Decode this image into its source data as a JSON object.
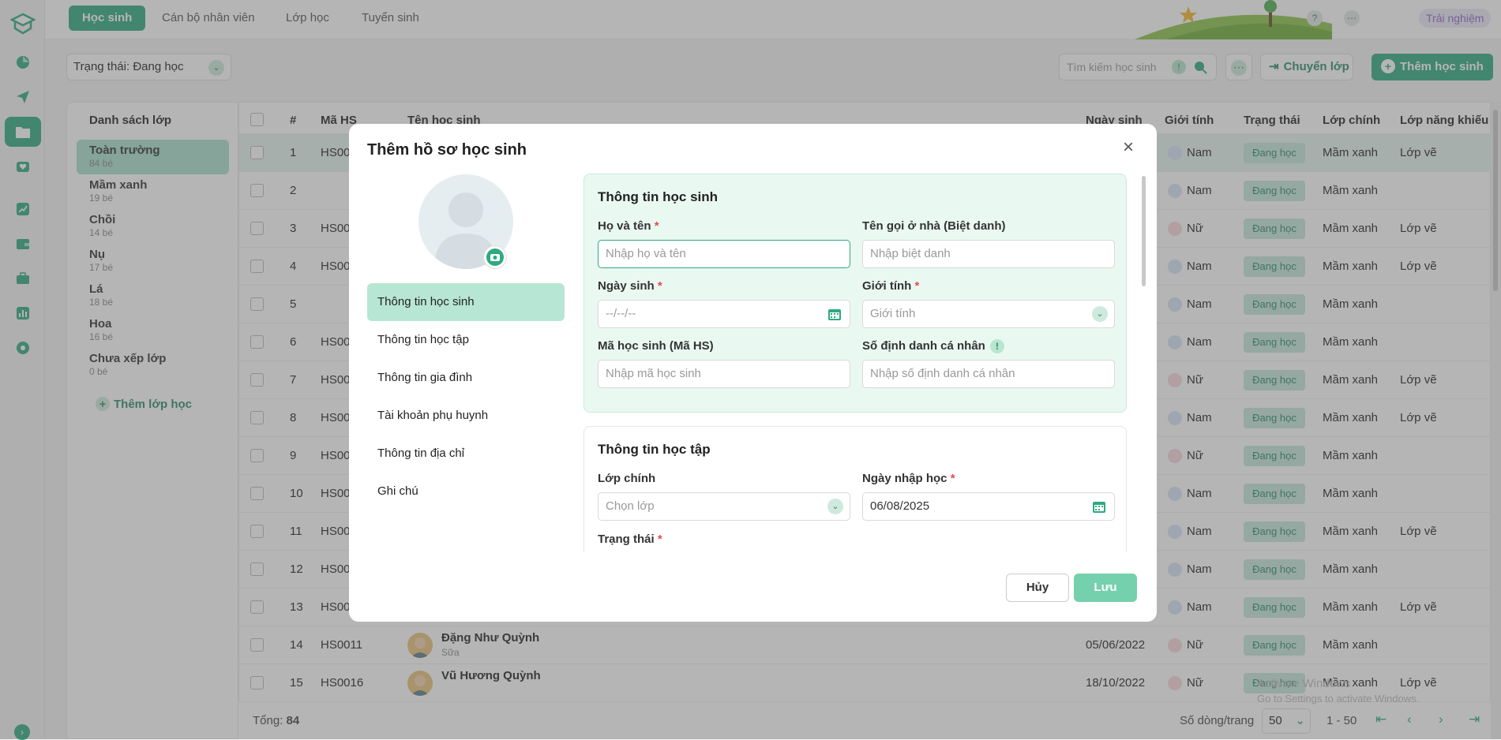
{
  "topbar": {
    "tabs": [
      "Học sinh",
      "Cán bộ nhân viên",
      "Lớp học",
      "Tuyển sinh"
    ],
    "trial_label": "Trải nghiệm"
  },
  "filter": {
    "status_label": "Trạng thái: Đang học",
    "search_placeholder": "Tìm kiếm học sinh",
    "move_class_label": "Chuyển lớp",
    "add_student_label": "Thêm học sinh"
  },
  "classes": {
    "title": "Danh sách lớp",
    "items": [
      {
        "name": "Toàn trường",
        "count": "84 bé"
      },
      {
        "name": "Mầm xanh",
        "count": "19 bé"
      },
      {
        "name": "Chồi",
        "count": "14 bé"
      },
      {
        "name": "Nụ",
        "count": "17 bé"
      },
      {
        "name": "Lá",
        "count": "18 bé"
      },
      {
        "name": "Hoa",
        "count": "16 bé"
      },
      {
        "name": "Chưa xếp lớp",
        "count": "0 bé"
      }
    ],
    "add_label": "Thêm lớp học"
  },
  "table": {
    "headers": {
      "num": "#",
      "code": "Mã HS",
      "name": "Tên học sinh",
      "dob": "Ngày sinh",
      "gender": "Giới tính",
      "status": "Trạng thái",
      "main_class": "Lớp chính",
      "talent_class": "Lớp năng khiếu"
    },
    "rows": [
      {
        "num": "1",
        "code": "HS00",
        "gender": "Nam",
        "status": "Đang học",
        "main_class": "Mầm xanh",
        "talent": "Lớp vẽ"
      },
      {
        "num": "2",
        "code": "",
        "gender": "Nam",
        "status": "Đang học",
        "main_class": "Mầm xanh",
        "talent": ""
      },
      {
        "num": "3",
        "code": "HS00",
        "gender": "Nữ",
        "status": "Đang học",
        "main_class": "Mầm xanh",
        "talent": "Lớp vẽ"
      },
      {
        "num": "4",
        "code": "HS00",
        "gender": "Nam",
        "status": "Đang học",
        "main_class": "Mầm xanh",
        "talent": "Lớp vẽ"
      },
      {
        "num": "5",
        "code": "",
        "gender": "Nam",
        "status": "Đang học",
        "main_class": "Mầm xanh",
        "talent": ""
      },
      {
        "num": "6",
        "code": "HS00",
        "gender": "Nam",
        "status": "Đang học",
        "main_class": "Mầm xanh",
        "talent": ""
      },
      {
        "num": "7",
        "code": "HS00",
        "gender": "Nữ",
        "status": "Đang học",
        "main_class": "Mầm xanh",
        "talent": "Lớp vẽ"
      },
      {
        "num": "8",
        "code": "HS00",
        "gender": "Nam",
        "status": "Đang học",
        "main_class": "Mầm xanh",
        "talent": "Lớp vẽ"
      },
      {
        "num": "9",
        "code": "HS00",
        "gender": "Nữ",
        "status": "Đang học",
        "main_class": "Mầm xanh",
        "talent": ""
      },
      {
        "num": "10",
        "code": "HS00",
        "gender": "Nam",
        "status": "Đang học",
        "main_class": "Mầm xanh",
        "talent": ""
      },
      {
        "num": "11",
        "code": "HS00",
        "gender": "Nam",
        "status": "Đang học",
        "main_class": "Mầm xanh",
        "talent": "Lớp vẽ"
      },
      {
        "num": "12",
        "code": "HS00",
        "gender": "Nam",
        "status": "Đang học",
        "main_class": "Mầm xanh",
        "talent": ""
      },
      {
        "num": "13",
        "code": "HS00",
        "gender": "Nam",
        "status": "Đang học",
        "main_class": "Mầm xanh",
        "talent": "Lớp vẽ"
      },
      {
        "num": "14",
        "code": "HS0011",
        "name": "Đặng Như Quỳnh",
        "nick": "Sữa",
        "dob": "05/06/2022",
        "gender": "Nữ",
        "status": "Đang học",
        "main_class": "Mầm xanh",
        "talent": ""
      },
      {
        "num": "15",
        "code": "HS0016",
        "name": "Vũ Hương Quỳnh",
        "nick": "",
        "dob": "18/10/2022",
        "gender": "Nữ",
        "status": "Đang học",
        "main_class": "Mầm xanh",
        "talent": "Lớp vẽ"
      }
    ],
    "footer": {
      "total_label": "Tổng:",
      "total": "84",
      "rows_per_page_label": "Số dòng/trang",
      "rows_per_page": "50",
      "range": "1 - 50"
    }
  },
  "modal": {
    "title": "Thêm hồ sơ học sinh",
    "nav": [
      "Thông tin học sinh",
      "Thông tin học tập",
      "Thông tin gia đình",
      "Tài khoản phụ huynh",
      "Thông tin địa chỉ",
      "Ghi chú"
    ],
    "student": {
      "title": "Thông tin học sinh",
      "name_label": "Họ và tên",
      "name_placeholder": "Nhập họ và tên",
      "nick_label": "Tên gọi ở nhà (Biệt danh)",
      "nick_placeholder": "Nhập biệt danh",
      "dob_label": "Ngày sinh",
      "dob_placeholder": "--/--/--",
      "gender_label": "Giới tính",
      "gender_placeholder": "Giới tính",
      "code_label": "Mã học sinh (Mã HS)",
      "code_placeholder": "Nhập mã học sinh",
      "id_label": "Số định danh cá nhân",
      "id_placeholder": "Nhập số định danh cá nhân"
    },
    "study": {
      "title": "Thông tin học tập",
      "class_label": "Lớp chính",
      "class_placeholder": "Chọn lớp",
      "enroll_label": "Ngày nhập học",
      "enroll_value": "06/08/2025",
      "status_label": "Trạng thái"
    },
    "cancel_label": "Hủy",
    "save_label": "Lưu"
  },
  "watermark": {
    "line1": "Activate Windows",
    "line2": "Go to Settings to activate Windows."
  }
}
